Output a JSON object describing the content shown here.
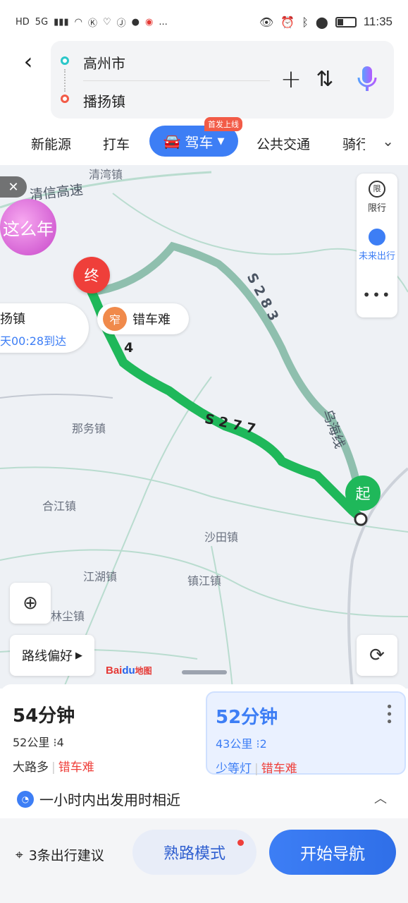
{
  "status_bar": {
    "left_icons": [
      "HD",
      "5G",
      "signal-icon",
      "wifi-icon",
      "k-icon",
      "heart-icon",
      "jd-icon",
      "shield-icon",
      "weibo-icon",
      "..."
    ],
    "time": "11:35"
  },
  "route": {
    "from": "高州市",
    "to": "播扬镇"
  },
  "modes": {
    "new_energy": "新能源",
    "taxi": "打车",
    "drive": "驾车",
    "drive_badge": "首发上线",
    "transit": "公共交通",
    "ride": "骑行"
  },
  "map": {
    "labels": {
      "qingwan": "清湾镇",
      "expressway": "清信高速",
      "nawu": "那务镇",
      "hejiang": "合江镇",
      "shatian": "沙田镇",
      "jianghu": "江湖镇",
      "zhenjiang": "镇江镇",
      "linchen": "林尘镇",
      "s283": "S 2 8 3",
      "s277": "S 2 7 7",
      "wuhai": "乌海线",
      "road4": "4"
    },
    "promo_text": "这么年",
    "side": {
      "limit": "限行",
      "limit_icon": "限",
      "future": "未来出行",
      "more": "•••"
    },
    "dest_marker": "终",
    "start_marker": "起",
    "dest_card": {
      "name": "扬镇",
      "eta": "天00:28到达"
    },
    "narrow": {
      "icon": "窄",
      "label": "错车难"
    },
    "route_pref": "路线偏好",
    "logo_bai": "Bai",
    "logo_du": "du",
    "logo_map": "地图"
  },
  "routes": [
    {
      "time": "54分钟",
      "distance": "52公里",
      "lights": "4",
      "tag1": "大路多",
      "tag2": "错车难"
    },
    {
      "time": "52分钟",
      "distance": "43公里",
      "lights": "2",
      "tag1": "少等灯",
      "tag2": "错车难"
    }
  ],
  "tip": "一小时内出发用时相近",
  "footer": {
    "suggest": "3条出行建议",
    "familiar": "熟路模式",
    "start": "开始导航"
  },
  "colors": {
    "accent": "#3d7ef5",
    "route_green": "#1fb85a",
    "alt_route": "#8fbfae",
    "warn": "#ef3f3a"
  }
}
